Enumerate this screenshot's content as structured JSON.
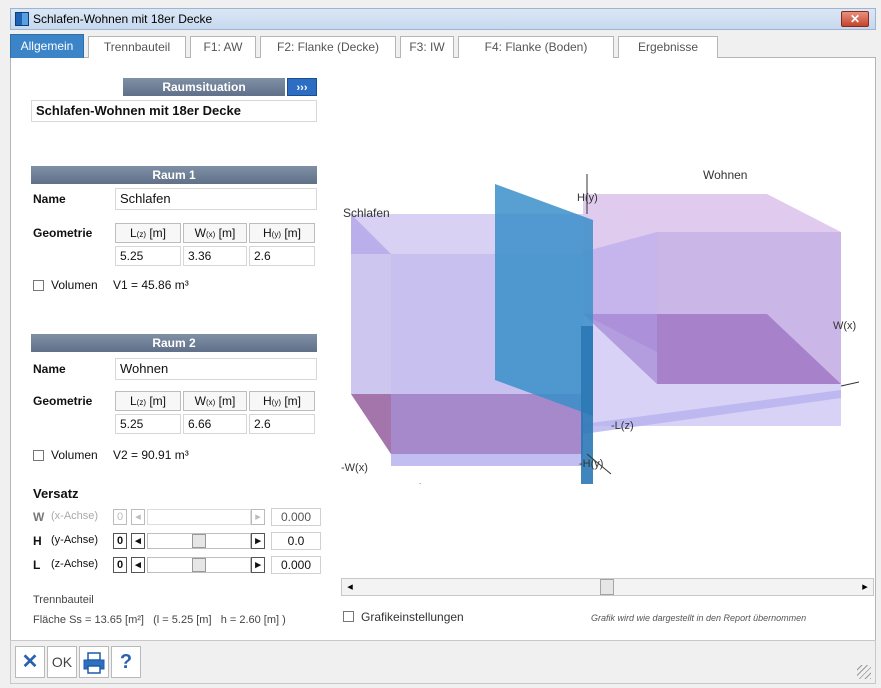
{
  "window": {
    "title": "Schlafen-Wohnen mit 18er Decke",
    "close": "✕"
  },
  "tabs": [
    "Allgemein",
    "Trennbauteil",
    "F1: AW",
    "F2: Flanke (Decke)",
    "F3: IW",
    "F4: Flanke (Boden)",
    "Ergebnisse"
  ],
  "raumsituation": {
    "header": "Raumsituation",
    "more": "›››",
    "value": "Schlafen-Wohnen mit 18er Decke"
  },
  "raum1": {
    "header": "Raum 1",
    "name_label": "Name",
    "name": "Schlafen",
    "geo_label": "Geometrie",
    "heads": [
      {
        "a": "L",
        "s": "(z)",
        "u": " [m]"
      },
      {
        "a": "W",
        "s": "(x)",
        "u": " [m]"
      },
      {
        "a": "H",
        "s": "(y)",
        "u": " [m]"
      }
    ],
    "values": [
      "5.25",
      "3.36",
      "2.6"
    ],
    "vol_label": "Volumen",
    "vol_text": "V1 = 45.86 m³"
  },
  "raum2": {
    "header": "Raum 2",
    "name_label": "Name",
    "name": "Wohnen",
    "geo_label": "Geometrie",
    "heads": [
      {
        "a": "L",
        "s": "(z)",
        "u": " [m]"
      },
      {
        "a": "W",
        "s": "(x)",
        "u": " [m]"
      },
      {
        "a": "H",
        "s": "(y)",
        "u": " [m]"
      }
    ],
    "values": [
      "5.25",
      "6.66",
      "2.6"
    ],
    "vol_label": "Volumen",
    "vol_text": "V2 = 90.91 m³"
  },
  "versatz": {
    "header": "Versatz",
    "rows": [
      {
        "letter": "W",
        "axis": "(x-Achse)",
        "zero": "0",
        "value": "0.000",
        "enabled": false
      },
      {
        "letter": "H",
        "axis": "(y-Achse)",
        "zero": "0",
        "value": "0.0",
        "enabled": true
      },
      {
        "letter": "L",
        "axis": "(z-Achse)",
        "zero": "0",
        "value": "0.000",
        "enabled": true
      }
    ]
  },
  "trennbauteil": {
    "label": "Trennbauteil",
    "flaeche": "Fläche Ss = 13.65 [m²]   (l = 5.25 [m]   h = 2.60 [m] )"
  },
  "graphic": {
    "label_schlafen": "Schlafen",
    "label_wohnen": "Wohnen",
    "axis_hy": "H(y)",
    "axis_wx": "W(x)",
    "axis_nlz": "-L(z)",
    "axis_nwx": "-W(x)",
    "axis_nhy": "-H(y)",
    "colors": {
      "room1": "#9f6fc8",
      "room2": "#c49ad8",
      "wall": "#3a8fc9"
    }
  },
  "grafik": {
    "label": "Grafikeinstellungen",
    "note": "Grafik wird wie dargestellt in den Report übernommen"
  },
  "bottom": {
    "cancel": "✕",
    "ok": "OK",
    "help": "?"
  }
}
